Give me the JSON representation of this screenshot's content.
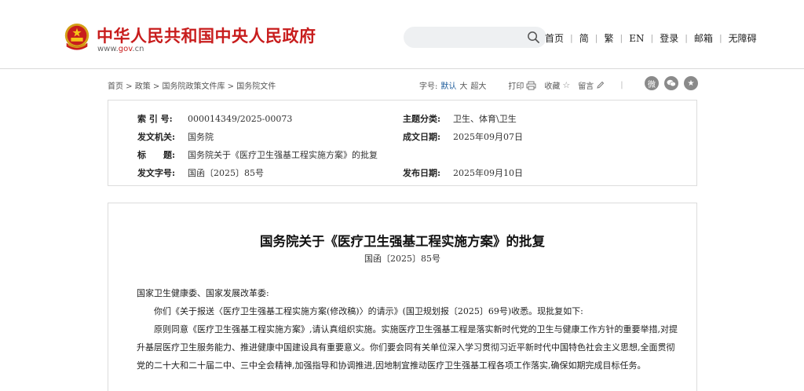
{
  "header": {
    "site_title": "中华人民共和国中央人民政府",
    "domain_prefix": "www.",
    "domain_main": "gov",
    "domain_suffix": ".cn",
    "search": {
      "placeholder": ""
    },
    "nav": [
      "首页",
      "简",
      "繁",
      "EN",
      "登录",
      "邮箱",
      "无障碍"
    ]
  },
  "breadcrumb": "首页 > 政策 > 国务院政策文件库 > 国务院文件",
  "tools": {
    "font_size_label": "字号:",
    "font_default": "默认",
    "font_large": "大",
    "font_xlarge": "超大",
    "print": "打印",
    "favorite": "收藏",
    "comment": "留言"
  },
  "share": [
    "weibo-icon",
    "wechat-icon",
    "qzone-icon"
  ],
  "info": {
    "index_label": "索 引 号:",
    "index_value": "000014349/2025-00073",
    "category_label": "主题分类:",
    "category_value": "卫生、体育\\卫生",
    "issuer_label": "发文机关:",
    "issuer_value": "国务院",
    "created_label": "成文日期:",
    "created_value": "2025年09月07日",
    "title_label": "标　　题:",
    "title_value": "国务院关于《医疗卫生强基工程实施方案》的批复",
    "docno_label": "发文字号:",
    "docno_value": "国函〔2025〕85号",
    "published_label": "发布日期:",
    "published_value": "2025年09月10日"
  },
  "article": {
    "title": "国务院关于《医疗卫生强基工程实施方案》的批复",
    "doc_no": "国函〔2025〕85号",
    "salutation": "国家卫生健康委、国家发展改革委:",
    "para1": "你们《关于报送〈医疗卫生强基工程实施方案(修改稿)〉的请示》(国卫规划报〔2025〕69号)收悉。现批复如下:",
    "para2": "原则同意《医疗卫生强基工程实施方案》,请认真组织实施。实施医疗卫生强基工程是落实新时代党的卫生与健康工作方针的重要举措,对提升基层医疗卫生服务能力、推进健康中国建设具有重要意义。你们要会同有关单位深入学习贯彻习近平新时代中国特色社会主义思想,全面贯彻党的二十大和二十届二中、三中全会精神,加强指导和协调推进,因地制宜推动医疗卫生强基工程各项工作落实,确保如期完成目标任务。"
  },
  "colors": {
    "brand_red": "#c81d1d",
    "link_blue": "#1c5b9b",
    "border": "#dcdcdc"
  }
}
